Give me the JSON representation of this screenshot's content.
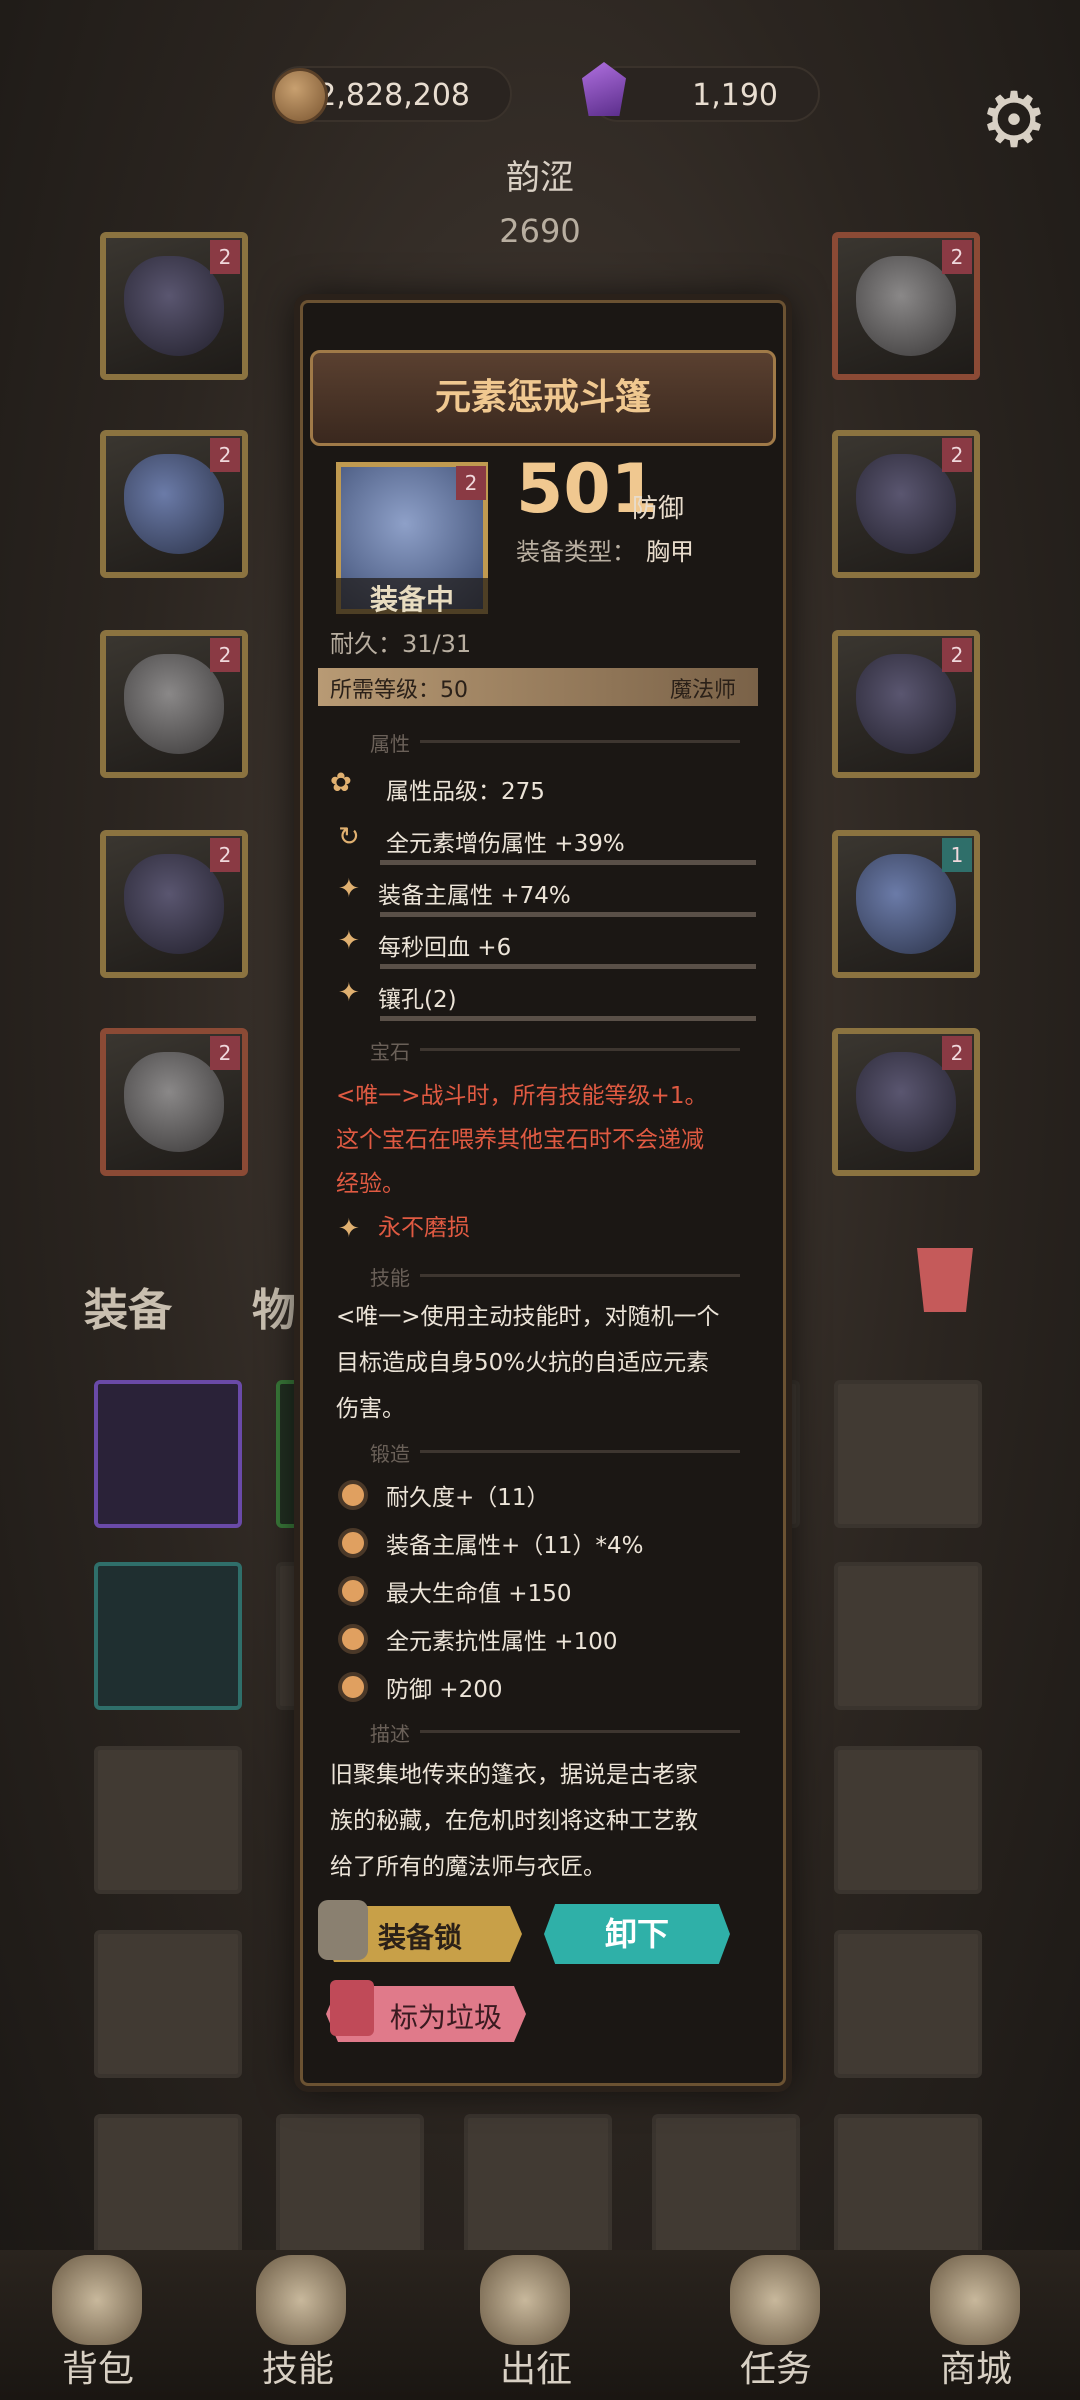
{
  "top": {
    "gold": "82,828,208",
    "gems": "1,190",
    "gold_icon": "coin-icon",
    "gem_icon": "crystal-icon",
    "settings_icon": "gear-icon"
  },
  "player": {
    "name": "韵涩",
    "power": "2690"
  },
  "tabs": {
    "equipment": "装备",
    "items": "物"
  },
  "item": {
    "title": "元素惩戒斗篷",
    "level_badge": "2",
    "equipped_label": "装备中",
    "stat_value": "501",
    "stat_name": "防御",
    "type_label": "装备类型：",
    "type_value": "胸甲",
    "durability": "耐久：31/31",
    "req_level": "所需等级：50",
    "req_class": "魔法师",
    "sections": {
      "attributes": "属性",
      "gem": "宝石",
      "skill": "技能",
      "forge": "锻造",
      "desc": "描述"
    },
    "quality": "属性品级：275",
    "attrs": [
      "全元素增伤属性 +39%",
      "装备主属性 +74%",
      "每秒回血 +6",
      "镶孔(2)"
    ],
    "gem_text": [
      "<唯一>战斗时，所有技能等级+1。",
      "这个宝石在喂养其他宝石时不会递减",
      "经验。"
    ],
    "no_wear": "永不磨损",
    "skill_text": [
      "<唯一>使用主动技能时，对随机一个",
      "目标造成自身50%火抗的自适应元素",
      "伤害。"
    ],
    "forge": [
      "耐久度+（11）",
      "装备主属性+（11）*4%",
      "最大生命值 +150",
      "全元素抗性属性 +100",
      "防御 +200"
    ],
    "description": [
      "旧聚集地传来的篷衣，据说是古老家",
      "族的秘藏，在危机时刻将这种工艺教",
      "给了所有的魔法师与衣匠。"
    ],
    "buttons": {
      "lock": "装备锁",
      "unload": "卸下",
      "trash": "标为垃圾"
    }
  },
  "nav": [
    "背包",
    "技能",
    "出征",
    "任务",
    "商城"
  ],
  "slot_levels": [
    "2",
    "2",
    "2",
    "2",
    "2",
    "2",
    "2",
    "2",
    "1",
    "2"
  ]
}
